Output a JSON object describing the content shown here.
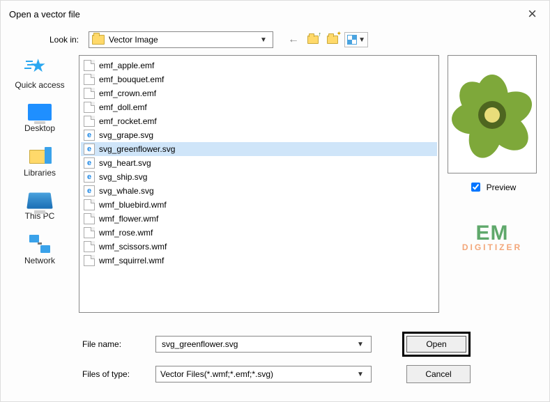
{
  "title": "Open a vector file",
  "lookin": {
    "label": "Look in:",
    "value": "Vector Image"
  },
  "places": {
    "quick": "Quick access",
    "desktop": "Desktop",
    "libraries": "Libraries",
    "thispc": "This PC",
    "network": "Network"
  },
  "files": [
    {
      "name": "emf_apple.emf",
      "icon": "doc"
    },
    {
      "name": "emf_bouquet.emf",
      "icon": "doc"
    },
    {
      "name": "emf_crown.emf",
      "icon": "doc"
    },
    {
      "name": "emf_doll.emf",
      "icon": "doc"
    },
    {
      "name": "emf_rocket.emf",
      "icon": "doc"
    },
    {
      "name": "svg_grape.svg",
      "icon": "ie"
    },
    {
      "name": "svg_greenflower.svg",
      "icon": "ie",
      "selected": true
    },
    {
      "name": "svg_heart.svg",
      "icon": "ie"
    },
    {
      "name": "svg_ship.svg",
      "icon": "ie"
    },
    {
      "name": "svg_whale.svg",
      "icon": "ie"
    },
    {
      "name": "wmf_bluebird.wmf",
      "icon": "doc"
    },
    {
      "name": "wmf_flower.wmf",
      "icon": "doc"
    },
    {
      "name": "wmf_rose.wmf",
      "icon": "doc"
    },
    {
      "name": "wmf_scissors.wmf",
      "icon": "doc"
    },
    {
      "name": "wmf_squirrel.wmf",
      "icon": "doc"
    }
  ],
  "preview": {
    "label": "Preview",
    "checked": true
  },
  "filename": {
    "label": "File name:",
    "value": "svg_greenflower.svg"
  },
  "filetype": {
    "label": "Files of type:",
    "value": "Vector Files(*.wmf;*.emf;*.svg)"
  },
  "buttons": {
    "open": "Open",
    "cancel": "Cancel"
  },
  "watermark": {
    "line1": "EM",
    "line2": "DIGITIZER"
  }
}
